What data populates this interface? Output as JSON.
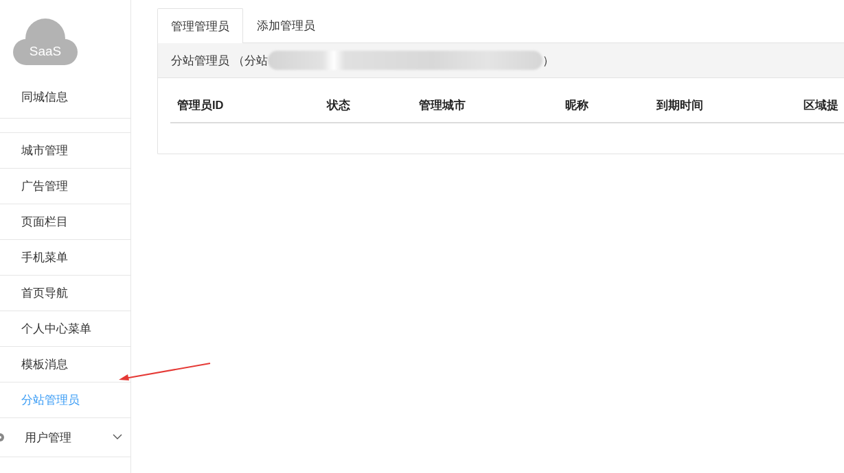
{
  "sidebar": {
    "logo": "SaaS",
    "header_item": "同城信息",
    "items": [
      {
        "label": "城市管理",
        "kind": "link",
        "selected": false
      },
      {
        "label": "广告管理",
        "kind": "link",
        "selected": false
      },
      {
        "label": "页面栏目",
        "kind": "link",
        "selected": false
      },
      {
        "label": "手机菜单",
        "kind": "link",
        "selected": false
      },
      {
        "label": "首页导航",
        "kind": "link",
        "selected": false
      },
      {
        "label": "个人中心菜单",
        "kind": "link",
        "selected": false
      },
      {
        "label": "模板消息",
        "kind": "link",
        "selected": false
      },
      {
        "label": "分站管理员",
        "kind": "link",
        "selected": true
      },
      {
        "label": "用户管理",
        "kind": "group",
        "selected": false,
        "expanded": false
      }
    ]
  },
  "tabs": [
    {
      "label": "管理管理员",
      "selected": true
    },
    {
      "label": "添加管理员",
      "selected": false
    }
  ],
  "panel": {
    "title": "分站管理员 （分站",
    "title_end": "）",
    "table": {
      "columns": [
        "管理员ID",
        "状态",
        "管理城市",
        "昵称",
        "到期时间",
        "区域提"
      ]
    }
  }
}
